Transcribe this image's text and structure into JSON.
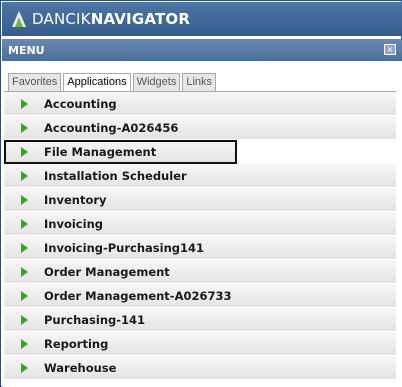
{
  "app": {
    "brand_light": "DANCIK",
    "brand_bold": "NAVIGATOR"
  },
  "menu": {
    "title": "MENU",
    "close_glyph": "×"
  },
  "tabs": [
    {
      "label": "Favorites",
      "active": false
    },
    {
      "label": "Applications",
      "active": true
    },
    {
      "label": "Widgets",
      "active": false
    },
    {
      "label": "Links",
      "active": false
    }
  ],
  "applications": [
    {
      "label": "Accounting"
    },
    {
      "label": "Accounting-A026456"
    },
    {
      "label": "File Management",
      "focused": true
    },
    {
      "label": "Installation Scheduler"
    },
    {
      "label": "Inventory"
    },
    {
      "label": "Invoicing"
    },
    {
      "label": "Invoicing-Purchasing141"
    },
    {
      "label": "Order Management"
    },
    {
      "label": "Order Management-A026733"
    },
    {
      "label": "Purchasing-141"
    },
    {
      "label": "Reporting"
    },
    {
      "label": "Warehouse"
    }
  ],
  "colors": {
    "header": "#345d8e",
    "arrow": "#37a21a",
    "row": "#ececec"
  },
  "icons": {
    "row_expand": "expand-arrow-icon",
    "logo": "dancik-logo-icon",
    "close": "close-icon"
  }
}
